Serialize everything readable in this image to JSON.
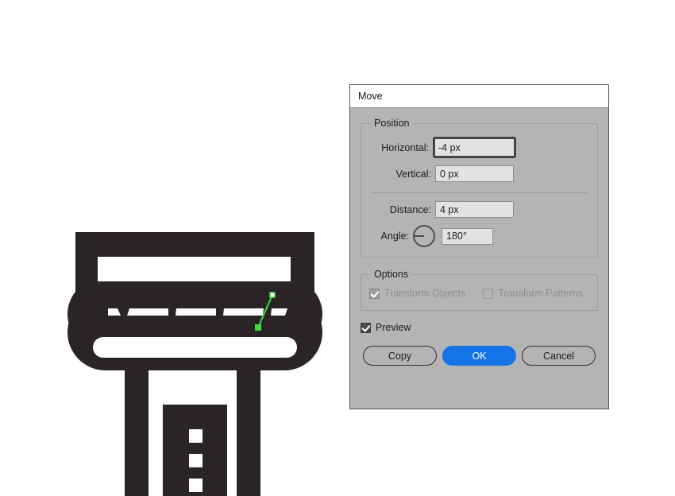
{
  "artwork": {
    "name": "air-conditioner-vector-illustration",
    "fill_color": "#2B2426",
    "background_color": "#FFFFFF",
    "selection_path_color": "#3BE03B",
    "anchor_point_color": "#3BE03B"
  },
  "dialog": {
    "title": "Move",
    "position_group": {
      "legend": "Position",
      "horizontal": {
        "label": "Horizontal:",
        "value": "-4 px",
        "focused": true
      },
      "vertical": {
        "label": "Vertical:",
        "value": "0 px",
        "focused": false
      },
      "distance": {
        "label": "Distance:",
        "value": "4 px",
        "focused": false
      },
      "angle": {
        "label": "Angle:",
        "value": "180°",
        "dial_degrees": 180,
        "focused": false
      }
    },
    "options_group": {
      "legend": "Options",
      "transform_objects": {
        "label": "Transform Objects",
        "checked": true,
        "enabled": false
      },
      "transform_patterns": {
        "label": "Transform Patterns",
        "checked": false,
        "enabled": false
      }
    },
    "preview": {
      "label": "Preview",
      "checked": true,
      "enabled": true
    },
    "buttons": {
      "copy": "Copy",
      "ok": "OK",
      "cancel": "Cancel"
    },
    "colors": {
      "dialog_background": "#B4B4B4",
      "titlebar_background": "#FFFFFF",
      "input_background": "#E2E2E2",
      "primary_button": "#1473E6",
      "border": "#585858"
    }
  }
}
